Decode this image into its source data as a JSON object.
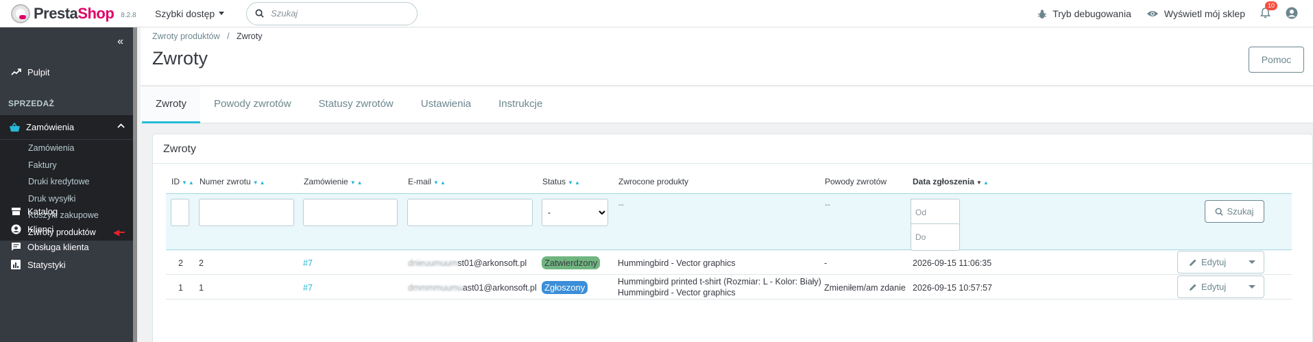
{
  "header": {
    "logo_text_a": "Presta",
    "logo_text_b": "Shop",
    "version": "8.2.8",
    "quick_access": "Szybki dostęp",
    "search_placeholder": "Szukaj",
    "debug_mode": "Tryb debugowania",
    "view_shop": "Wyświetl mój sklep",
    "notifications_count": "10"
  },
  "sidebar": {
    "collapse_glyph": "«",
    "dashboard": "Pulpit",
    "section_sales": "SPRZEDAŻ",
    "orders": "Zamówienia",
    "sub_items": [
      "Zamówienia",
      "Faktury",
      "Druki kredytowe",
      "Druk wysyłki",
      "Koszyki zakupowe",
      "Zwroty produktów"
    ],
    "catalog": "Katalog",
    "customers": "Klienci",
    "customer_service": "Obsługa klienta",
    "stats": "Statystyki"
  },
  "page": {
    "breadcrumb_parent": "Zwroty produktów",
    "breadcrumb_sep": "/",
    "breadcrumb_current": "Zwroty",
    "title": "Zwroty",
    "help_button": "Pomoc"
  },
  "tabs": [
    "Zwroty",
    "Powody zwrotów",
    "Statusy zwrotów",
    "Ustawienia",
    "Instrukcje"
  ],
  "panel": {
    "title": "Zwroty",
    "columns": {
      "id": "ID",
      "return_number": "Numer zwrotu",
      "order": "Zamówienie",
      "email": "E-mail",
      "status": "Status",
      "returned_products": "Zwrocone produkty",
      "return_reasons": "Powody zwrotów",
      "date": "Data zgłoszenia"
    },
    "filters": {
      "status_selected": "-",
      "products_dash": "--",
      "reasons_dash": "--",
      "date_from_placeholder": "Od",
      "date_to_placeholder": "Do",
      "search_button": "Szukaj"
    },
    "rows": [
      {
        "id": "2",
        "number": "2",
        "order": "#7",
        "email_hidden": "dnieuumuum",
        "email_visible": "st01@arkonsoft.pl",
        "status": "Zatwierdzony",
        "products": [
          "Hummingbird - Vector graphics"
        ],
        "reason": "-",
        "date": "2026-09-15 11:06:35",
        "edit": "Edytuj"
      },
      {
        "id": "1",
        "number": "1",
        "order": "#7",
        "email_hidden": "dmmmmuumu",
        "email_visible": "ast01@arkonsoft.pl",
        "status": "Zgłoszony",
        "products": [
          "Hummingbird printed t-shirt (Rozmiar: L - Kolor: Biały)",
          "Hummingbird - Vector graphics"
        ],
        "reason": "Zmieniłem/am zdanie",
        "date": "2026-09-15 10:57:57",
        "edit": "Edytuj"
      }
    ]
  },
  "colors": {
    "accent": "#25b9d7",
    "brand": "#df0067",
    "sidebar": "#363a41",
    "status_approved": "#70b580",
    "status_reported": "#3b8ed8"
  }
}
